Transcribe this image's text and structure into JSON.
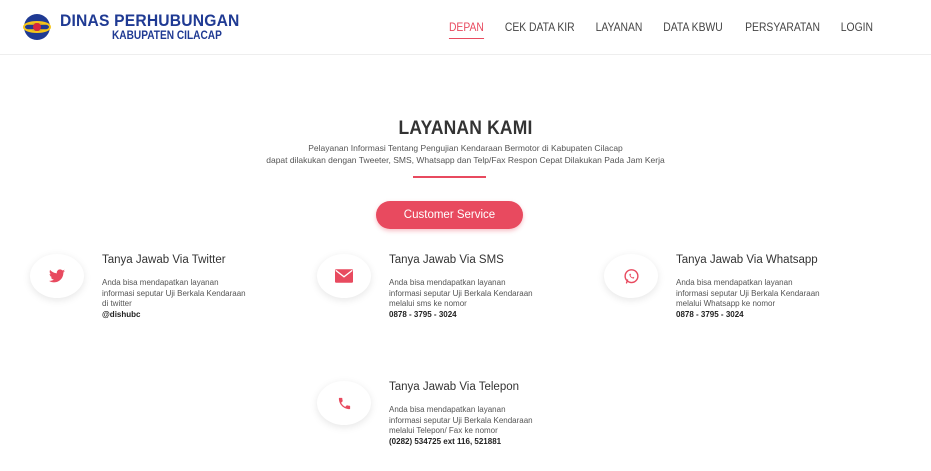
{
  "brand": {
    "title": "DINAS PERHUBUNGAN",
    "subtitle": "KABUPATEN CILACAP"
  },
  "nav": {
    "items": [
      {
        "label": "DEPAN"
      },
      {
        "label": "CEK DATA KIR"
      },
      {
        "label": "LAYANAN"
      },
      {
        "label": "DATA KBWU"
      },
      {
        "label": "PERSYARATAN"
      },
      {
        "label": "LOGIN"
      }
    ]
  },
  "section": {
    "title": "LAYANAN KAMI",
    "desc_line1": "Pelayanan Informasi Tentang Pengujian Kendaraan Bermotor di Kabupaten Cilacap",
    "desc_line2": "dapat dilakukan dengan Tweeter, SMS, Whatsapp dan Telp/Fax Respon Cepat Dilakukan Pada Jam Kerja",
    "button_label": "Customer Service"
  },
  "services": [
    {
      "title": "Tanya Jawab Via Twitter",
      "line1": "Anda bisa mendapatkan layanan",
      "line2": "informasi seputar Uji Berkala Kendaraan",
      "line3": "di twitter",
      "contact": "@dishubc",
      "icon": "twitter-icon"
    },
    {
      "title": "Tanya Jawab Via SMS",
      "line1": "Anda bisa mendapatkan layanan",
      "line2": "informasi seputar Uji Berkala Kendaraan",
      "line3": "melalui sms ke nomor",
      "contact": "0878 - 3795 - 3024",
      "icon": "envelope-icon"
    },
    {
      "title": "Tanya Jawab Via Whatsapp",
      "line1": "Anda bisa mendapatkan layanan",
      "line2": "informasi seputar Uji Berkala Kendaraan",
      "line3": "melalui Whatsapp ke nomor",
      "contact": "0878 - 3795 - 3024",
      "icon": "whatsapp-icon"
    },
    {
      "title": "Tanya Jawab Via Telepon",
      "line1": "Anda bisa mendapatkan layanan",
      "line2": "informasi seputar Uji Berkala Kendaraan",
      "line3": "melalui Telepon/ Fax ke nomor",
      "contact": "(0282) 534725 ext 116, 521881",
      "icon": "phone-icon"
    }
  ],
  "colors": {
    "accent": "#e84a5f",
    "brand": "#1f3a93"
  }
}
